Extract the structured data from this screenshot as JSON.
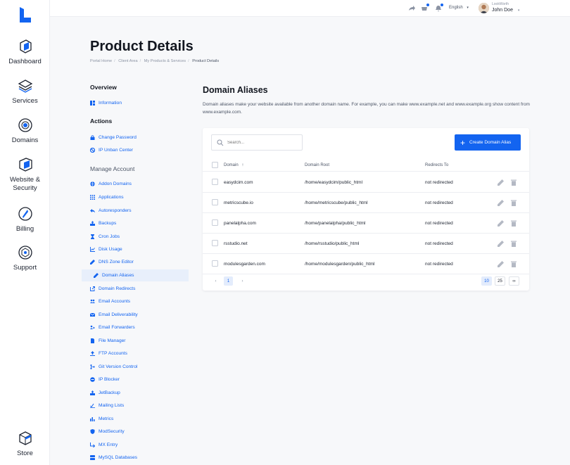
{
  "colors": {
    "accent": "#1364f0",
    "text": "#1d2330",
    "muted": "#8b93a3",
    "background": "#f7f8fa"
  },
  "rail": {
    "logo_icon": "brand-logo-icon",
    "items": [
      {
        "label": "Dashboard",
        "icon": "dashboard-icon"
      },
      {
        "label": "Services",
        "icon": "layers-icon"
      },
      {
        "label": "Domains",
        "icon": "globe-icon"
      },
      {
        "label": "Website & Security",
        "icon": "shield-box-icon"
      },
      {
        "label": "Billing",
        "icon": "billing-icon"
      },
      {
        "label": "Support",
        "icon": "support-icon"
      },
      {
        "label": "Store",
        "icon": "store-cube-icon"
      }
    ]
  },
  "topbar": {
    "language": "English",
    "user_brand": "LookWorth",
    "user_name": "John Doe"
  },
  "page": {
    "title": "Product Details",
    "breadcrumb": [
      "Portal Home",
      "Client Area",
      "My Products & Services",
      "Product Details"
    ]
  },
  "sidebar": {
    "overview_heading": "Overview",
    "overview_items": [
      {
        "label": "Information",
        "icon": "info-grid-icon"
      }
    ],
    "actions_heading": "Actions",
    "actions_items": [
      {
        "label": "Change Password",
        "icon": "lock-icon"
      },
      {
        "label": "IP Unban Center",
        "icon": "ban-icon"
      }
    ],
    "manage_heading": "Manage Account",
    "manage_items": [
      {
        "label": "Addon Domains",
        "icon": "globe-small-icon"
      },
      {
        "label": "Applications",
        "icon": "apps-icon"
      },
      {
        "label": "Autoresponders",
        "icon": "reply-icon"
      },
      {
        "label": "Backups",
        "icon": "backup-icon"
      },
      {
        "label": "Cron Jobs",
        "icon": "hourglass-icon"
      },
      {
        "label": "Disk Usage",
        "icon": "chart-icon"
      },
      {
        "label": "DNS Zone Editor",
        "icon": "pencil-icon"
      },
      {
        "label": "Domain Aliases",
        "icon": "pencil-icon"
      },
      {
        "label": "Domain Redirects",
        "icon": "redirect-icon"
      },
      {
        "label": "Email Accounts",
        "icon": "users-icon"
      },
      {
        "label": "Email Deliverability",
        "icon": "mail-icon"
      },
      {
        "label": "Email Forwarders",
        "icon": "forward-icon"
      },
      {
        "label": "File Manager",
        "icon": "file-icon"
      },
      {
        "label": "FTP Accounts",
        "icon": "upload-icon"
      },
      {
        "label": "Git Version Control",
        "icon": "git-icon"
      },
      {
        "label": "IP Blocker",
        "icon": "block-icon"
      },
      {
        "label": "JetBackup",
        "icon": "backup-icon"
      },
      {
        "label": "Mailing Lists",
        "icon": "list-icon"
      },
      {
        "label": "Metrics",
        "icon": "metrics-icon"
      },
      {
        "label": "ModSecurity",
        "icon": "shield-icon"
      },
      {
        "label": "MX Entry",
        "icon": "mx-icon"
      },
      {
        "label": "MySQL Databases",
        "icon": "database-icon"
      }
    ]
  },
  "main": {
    "title": "Domain Aliases",
    "description": "Domain aliases make your website available from another domain name. For example, you can make www.example.net and www.example.org show content from www.example.com.",
    "search_placeholder": "Search...",
    "create_button": "Create Domain Alias",
    "columns": [
      "Domain",
      "Domain Root",
      "Redirects To"
    ],
    "sort_indicator": "↑",
    "rows": [
      {
        "domain": "easydcim.com",
        "root": "/home/easydcim/public_html",
        "redirect": "not redirected"
      },
      {
        "domain": "metricscube.io",
        "root": "/home/metricscube/public_html",
        "redirect": "not redirected"
      },
      {
        "domain": "panelalpha.com",
        "root": "/home/panelalpha/public_html",
        "redirect": "not redirected"
      },
      {
        "domain": "rsstudio.net",
        "root": "/home/rsstudio/public_html",
        "redirect": "not redirected"
      },
      {
        "domain": "modulesgarden.com",
        "root": "/home/modulesgarden/public_html",
        "redirect": "not redirected"
      }
    ],
    "pagination": {
      "prev": "‹",
      "current_page": "1",
      "next": "›",
      "page_sizes": [
        "10",
        "25",
        "∞"
      ]
    }
  }
}
